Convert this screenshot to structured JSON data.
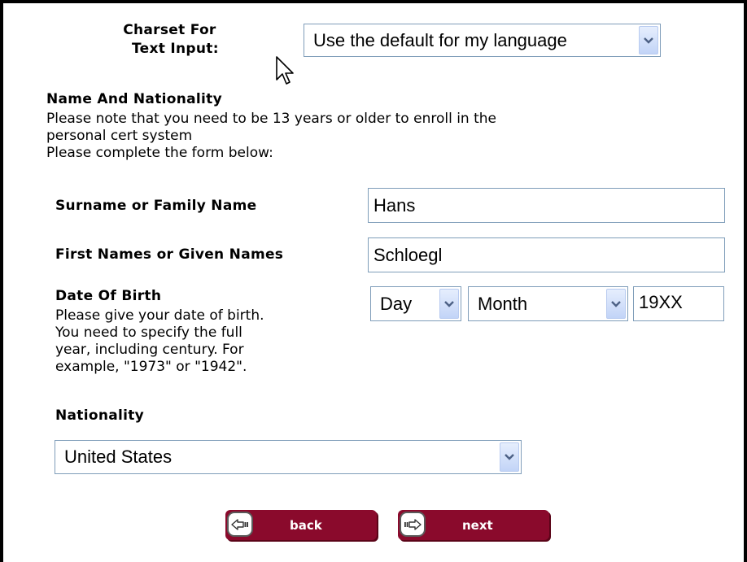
{
  "charset": {
    "label_line1": "Charset For",
    "label_line2": "Text Input:",
    "selected": "Use the default for my language"
  },
  "section": {
    "title": "Name And Nationality",
    "note_line1": "Please note that you need to be 13 years or older to enroll in the",
    "note_line2": "personal cert system",
    "instruction": "Please complete the form below:"
  },
  "surname": {
    "label": "Surname or Family Name",
    "value": "Hans"
  },
  "first_names": {
    "label": "First Names or Given Names",
    "value": "Schloegl"
  },
  "dob": {
    "label": "Date Of Birth",
    "help_line1": "Please give your date of birth.",
    "help_line2": "You need to specify the full",
    "help_line3": "year, including century. For",
    "help_line4": "example, \"1973\" or \"1942\".",
    "day_selected": "Day",
    "month_selected": "Month",
    "year_value": "19XX"
  },
  "nationality": {
    "label": "Nationality",
    "selected": "United States"
  },
  "buttons": {
    "back_label": "back",
    "next_label": "next"
  },
  "icons": [
    "chevron-down-icon",
    "arrow-left-icon",
    "arrow-right-icon",
    "mouse-pointer-icon"
  ],
  "colors": {
    "button_bg": "#8a0a2c",
    "field_border": "#7f9db9",
    "dropdown_arrow": "#4d6185"
  }
}
